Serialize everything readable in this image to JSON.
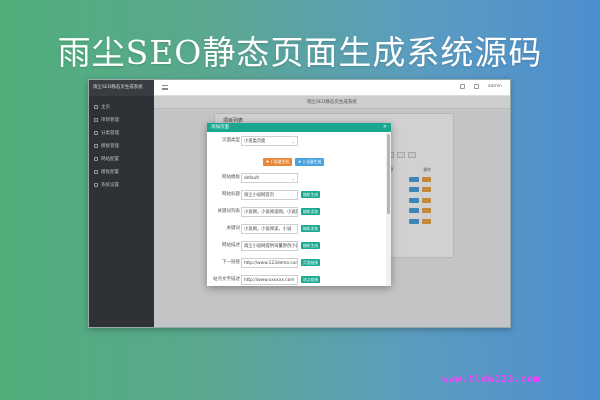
{
  "banner": {
    "title": "雨尘SEO静态页面生成系统源码"
  },
  "app": {
    "brand": "雨尘SEO静态页生成系统",
    "nav": [
      {
        "label": "主页"
      },
      {
        "label": "项目管理"
      },
      {
        "label": "分类管理"
      },
      {
        "label": "模板管理"
      },
      {
        "label": "网站配置"
      },
      {
        "label": "模板配置"
      },
      {
        "label": "系统设置"
      }
    ],
    "topbar": {
      "user": "admin"
    },
    "tab": {
      "label": "雨尘SEO静态页生成系统"
    },
    "panel": {
      "title": "项目列表"
    },
    "table": {
      "header_left": "排序",
      "header_right": "操作"
    }
  },
  "modal": {
    "title": "添加页面",
    "close": "×",
    "rows": [
      {
        "label": "页面类型",
        "value": "小说类页面",
        "kind": "select"
      },
      {
        "label": "网站模板",
        "value": "default",
        "kind": "select"
      },
      {
        "label": "网站标题",
        "value": "雨尘小说网首页",
        "kind": "input",
        "button": "随机生成"
      },
      {
        "label": "关键词列表",
        "value": "小说网，小说阅读网，小说网",
        "kind": "input",
        "button": "随机添加"
      },
      {
        "label": "关键词",
        "value": "小说网，小说阅读，小说",
        "kind": "input",
        "button": "随机添加"
      },
      {
        "label": "网站描述",
        "value": "雨尘小说网提供海量原创小说",
        "kind": "input",
        "button": "随机生成"
      },
      {
        "label": "下一链接",
        "value": "http://www.123demo.com",
        "kind": "input",
        "button": "页面链接"
      },
      {
        "label": "站点文字描述",
        "value": "http://www.xxxxxx.com",
        "kind": "input",
        "button": "站点链接"
      }
    ],
    "actions": {
      "primary": "✚ 1.批量生成",
      "secondary": "⊕ 2.全量生成"
    }
  },
  "watermark": "www.tldw123.com",
  "colors": {
    "accent": "#1ba68f",
    "sidebar": "#2e3236",
    "watermark": "#ff3fff"
  }
}
